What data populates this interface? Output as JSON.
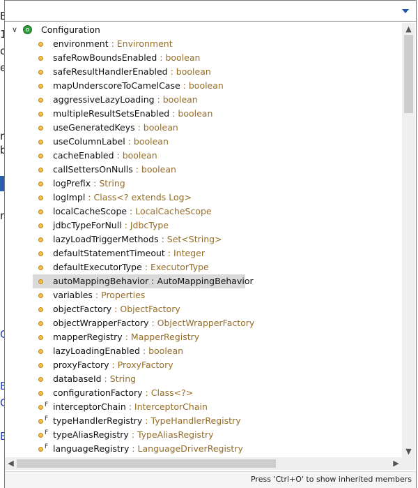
{
  "search": {
    "value": ""
  },
  "tree": {
    "root": {
      "label": "Configuration"
    },
    "items": [
      {
        "name": "environment",
        "type": "Environment",
        "final": false
      },
      {
        "name": "safeRowBoundsEnabled",
        "type": "boolean",
        "final": false
      },
      {
        "name": "safeResultHandlerEnabled",
        "type": "boolean",
        "final": false
      },
      {
        "name": "mapUnderscoreToCamelCase",
        "type": "boolean",
        "final": false
      },
      {
        "name": "aggressiveLazyLoading",
        "type": "boolean",
        "final": false
      },
      {
        "name": "multipleResultSetsEnabled",
        "type": "boolean",
        "final": false
      },
      {
        "name": "useGeneratedKeys",
        "type": "boolean",
        "final": false
      },
      {
        "name": "useColumnLabel",
        "type": "boolean",
        "final": false
      },
      {
        "name": "cacheEnabled",
        "type": "boolean",
        "final": false
      },
      {
        "name": "callSettersOnNulls",
        "type": "boolean",
        "final": false
      },
      {
        "name": "logPrefix",
        "type": "String",
        "final": false
      },
      {
        "name": "logImpl",
        "type": "Class<? extends Log>",
        "final": false
      },
      {
        "name": "localCacheScope",
        "type": "LocalCacheScope",
        "final": false
      },
      {
        "name": "jdbcTypeForNull",
        "type": "JdbcType",
        "final": false
      },
      {
        "name": "lazyLoadTriggerMethods",
        "type": "Set<String>",
        "final": false
      },
      {
        "name": "defaultStatementTimeout",
        "type": "Integer",
        "final": false
      },
      {
        "name": "defaultExecutorType",
        "type": "ExecutorType",
        "final": false
      },
      {
        "name": "autoMappingBehavior",
        "type": "AutoMappingBehavior",
        "final": false,
        "selected": true
      },
      {
        "name": "variables",
        "type": "Properties",
        "final": false
      },
      {
        "name": "objectFactory",
        "type": "ObjectFactory",
        "final": false
      },
      {
        "name": "objectWrapperFactory",
        "type": "ObjectWrapperFactory",
        "final": false
      },
      {
        "name": "mapperRegistry",
        "type": "MapperRegistry",
        "final": false
      },
      {
        "name": "lazyLoadingEnabled",
        "type": "boolean",
        "final": false
      },
      {
        "name": "proxyFactory",
        "type": "ProxyFactory",
        "final": false
      },
      {
        "name": "databaseId",
        "type": "String",
        "final": false
      },
      {
        "name": "configurationFactory",
        "type": "Class<?>",
        "final": false
      },
      {
        "name": "interceptorChain",
        "type": "InterceptorChain",
        "final": true
      },
      {
        "name": "typeHandlerRegistry",
        "type": "TypeHandlerRegistry",
        "final": true
      },
      {
        "name": "typeAliasRegistry",
        "type": "TypeAliasRegistry",
        "final": true
      },
      {
        "name": "languageRegistry",
        "type": "LanguageDriverRegistry",
        "final": true
      }
    ]
  },
  "status": {
    "hint": "Press 'Ctrl+O' to show inherited members"
  },
  "colors": {
    "type_text": "#956d28",
    "selection": "#dadada",
    "class_icon": "#2e9b3a",
    "field_icon": "#f0c14a"
  }
}
